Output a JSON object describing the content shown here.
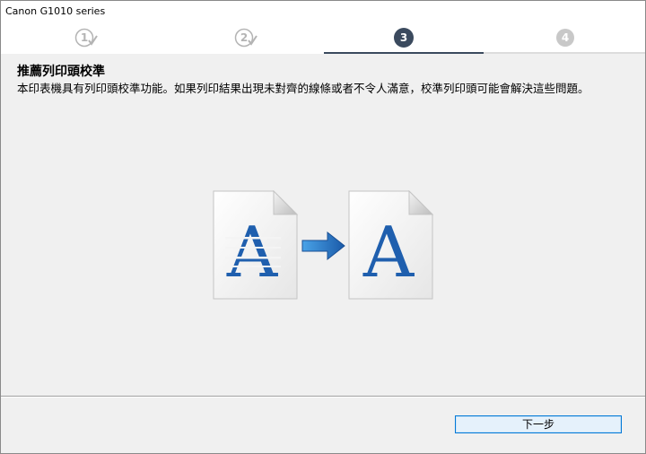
{
  "window": {
    "title": "Canon G1010 series"
  },
  "steps": [
    {
      "label": "1",
      "state": "done"
    },
    {
      "label": "2",
      "state": "done"
    },
    {
      "label": "3",
      "state": "current"
    },
    {
      "label": "4",
      "state": "pending"
    }
  ],
  "content": {
    "heading": "推薦列印頭校準",
    "description": "本印表機具有列印頭校準功能。如果列印結果出現未對齊的線條或者不令人滿意，校準列印頭可能會解決這些問題。"
  },
  "illustration": {
    "before_letter": "A",
    "after_letter": "A"
  },
  "footer": {
    "next_label": "下一步"
  },
  "colors": {
    "step_current": "#3b4a5e",
    "step_pending": "#c8c8c8",
    "step_done": "#b4b4b4",
    "letter_blue": "#1f5fae",
    "arrow_blue": "#2a78c9",
    "button_border": "#0078d7"
  }
}
